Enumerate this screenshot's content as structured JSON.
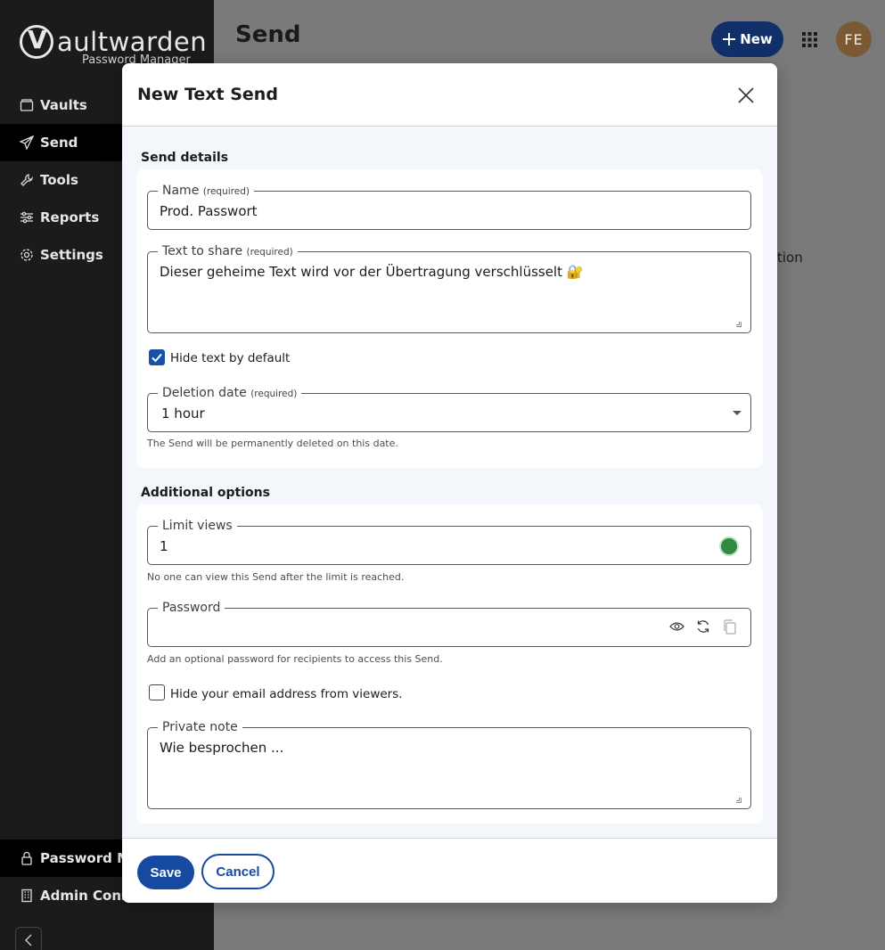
{
  "sidebar": {
    "logo_text": "aultwarden",
    "logo_sub": "Password Manager",
    "items": [
      {
        "label": "Vaults"
      },
      {
        "label": "Send"
      },
      {
        "label": "Tools"
      },
      {
        "label": "Reports"
      },
      {
        "label": "Settings"
      }
    ],
    "bottom_items": [
      {
        "label": "Password M"
      },
      {
        "label": "Admin Cons"
      }
    ]
  },
  "header": {
    "title": "Send",
    "new_label": "New",
    "avatar_initials": "FE"
  },
  "background": {
    "partial_text": "tion"
  },
  "dialog": {
    "title": "New Text Send",
    "send_details": {
      "title": "Send details",
      "name_label": "Name",
      "name_required": "(required)",
      "name_value": "Prod. Passwort",
      "text_label": "Text to share",
      "text_required": "(required)",
      "text_value": "Dieser geheime Text wird vor der Übertragung verschlüsselt 🔐",
      "hide_text_label": "Hide text by default",
      "deletion_label": "Deletion date",
      "deletion_required": "(required)",
      "deletion_value": "1 hour",
      "deletion_hint": "The Send will be permanently deleted on this date."
    },
    "additional_options": {
      "title": "Additional options",
      "limit_views_label": "Limit views",
      "limit_views_value": "1",
      "limit_views_hint": "No one can view this Send after the limit is reached.",
      "password_label": "Password",
      "password_value": "",
      "password_hint": "Add an optional password for recipients to access this Send.",
      "hide_email_label": "Hide your email address from viewers.",
      "private_note_label": "Private note",
      "private_note_value": "Wie besprochen ..."
    },
    "save_label": "Save",
    "cancel_label": "Cancel"
  }
}
